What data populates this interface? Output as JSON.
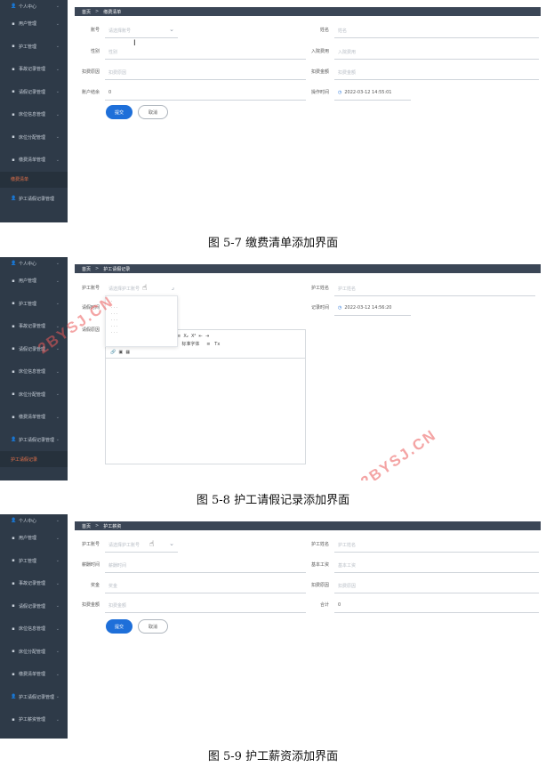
{
  "sidebar_icons": {
    "user": "user-icon",
    "grid": "grid-icon",
    "chevron": "chevron-down-icon"
  },
  "screen1": {
    "sidebar": [
      "个人中心",
      "用户管理",
      "护工管理",
      "事故记录管理",
      "请假记录管理",
      "床位信息管理",
      "床位分配管理",
      "缴费清单管理"
    ],
    "sidebar_sub": "缴费清单",
    "sidebar_after": "护工请假记录管理",
    "breadcrumb": {
      "home": "首页",
      "current": "缴费清单"
    },
    "fields": [
      {
        "label": "账号",
        "placeholder": "请选择账号"
      },
      {
        "label": "姓名",
        "placeholder": "姓名"
      },
      {
        "label": "性别",
        "placeholder": "性别"
      },
      {
        "label": "入院费用",
        "placeholder": "入院费用"
      },
      {
        "label": "扣费原因",
        "placeholder": "扣费原因"
      },
      {
        "label": "扣费金额",
        "placeholder": "扣费金额"
      },
      {
        "label": "账户结余",
        "value": "0"
      },
      {
        "label": "操作时间",
        "value": "2022-03-12 14:55:01"
      }
    ],
    "submit": "提交",
    "cancel": "取消"
  },
  "caption1": "图 5-7 缴费清单添加界面",
  "screen2": {
    "sidebar": [
      "个人中心",
      "用户管理",
      "护工管理",
      "事故记录管理",
      "请假记录管理",
      "床位信息管理",
      "床位分配管理",
      "缴费清单管理",
      "护工请假记录管理"
    ],
    "sidebar_sub": "护工请假记录",
    "breadcrumb": {
      "home": "首页",
      "current": "护工请假记录"
    },
    "fields": [
      {
        "label": "护工账号",
        "placeholder": "请选择护工账号"
      },
      {
        "label": "护工姓名",
        "placeholder": "护工姓名"
      },
      {
        "label": "请假时间",
        "placeholder": ""
      },
      {
        "label": "记录时间",
        "value": "2022-03-12 14:56:20"
      },
      {
        "label": "请假原因",
        "placeholder": ""
      }
    ],
    "editor_toolbar": {
      "row1": [
        "B",
        "I",
        "U",
        "S",
        "99",
        "<>",
        "H1",
        "H2",
        "≡",
        "≡",
        "X₂",
        "X²",
        "⇤",
        "⇥"
      ],
      "row2_text": "文本",
      "row2_font": "标准字体",
      "row2_extra": [
        "A",
        "Ā",
        "≡",
        "Tx"
      ],
      "row3": [
        "🔗",
        "▣",
        "▦"
      ]
    },
    "watermark": "2BYSJ.CN"
  },
  "caption2": "图 5-8 护工请假记录添加界面",
  "screen3": {
    "sidebar": [
      "个人中心",
      "用户管理",
      "护工管理",
      "事故记录管理",
      "请假记录管理",
      "床位信息管理",
      "床位分配管理",
      "缴费清单管理",
      "护工请假记录管理",
      "护工薪资管理"
    ],
    "breadcrumb": {
      "home": "首页",
      "current": "护工薪资"
    },
    "fields": [
      {
        "label": "护工账号",
        "placeholder": "请选择护工账号"
      },
      {
        "label": "护工姓名",
        "placeholder": "护工姓名"
      },
      {
        "label": "薪酬时间",
        "placeholder": "薪酬时间"
      },
      {
        "label": "基本工资",
        "placeholder": "基本工资"
      },
      {
        "label": "奖金",
        "placeholder": "奖金"
      },
      {
        "label": "扣费原因",
        "placeholder": "扣费原因"
      },
      {
        "label": "扣费金额",
        "placeholder": "扣费金额"
      },
      {
        "label": "合计",
        "value": "0"
      }
    ],
    "submit": "提交",
    "cancel": "取消"
  },
  "caption3": "图 5-9 护工薪资添加界面"
}
